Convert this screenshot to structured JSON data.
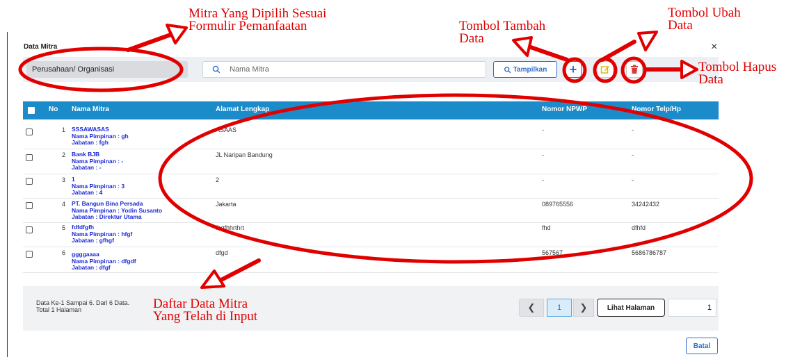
{
  "modal": {
    "title": "Data Mitra",
    "close": "×"
  },
  "filter": {
    "type_value": "Perusahaan/ Organisasi",
    "search_placeholder": "Nama Mitra",
    "search_value": "",
    "show_label": "Tampilkan"
  },
  "icons": {
    "search": "search-icon",
    "add": "plus-icon",
    "edit": "pencil-square-icon",
    "delete": "trash-icon",
    "close": "close-icon"
  },
  "colors": {
    "header_bg": "#1b8bc9",
    "accent": "#2f6ec7",
    "edit_icon": "#e0b400",
    "delete_icon": "#d83a3a",
    "name_text": "#1a28d6",
    "annotation": "#e10000"
  },
  "table": {
    "columns": [
      "No",
      "Nama Mitra",
      "Alamat Lengkap",
      "Nomor NPWP",
      "Nomor Telp/Hp"
    ],
    "rows": [
      {
        "no": "1",
        "name": "SSSAWASAS",
        "pimpinan": "Nama Pimpinan : gh",
        "jabatan": "Jabatan : fgh",
        "alamat": "ASAAS",
        "npwp": "-",
        "telp": "-"
      },
      {
        "no": "2",
        "name": "Bank BJB",
        "pimpinan": "Nama Pimpinan : -",
        "jabatan": "Jabatan : -",
        "alamat": "JL Naripan Bandung",
        "npwp": "-",
        "telp": "-"
      },
      {
        "no": "3",
        "name": "1",
        "pimpinan": "Nama Pimpinan : 3",
        "jabatan": "Jabatan : 4",
        "alamat": "2",
        "npwp": "-",
        "telp": "-"
      },
      {
        "no": "4",
        "name": "PT. Bangun Bina Persada",
        "pimpinan": "Nama Pimpinan : Yodin Susanto",
        "jabatan": "Jabatan : Direktur Utama",
        "alamat": "Jakarta",
        "npwp": "089765556",
        "telp": "34242432"
      },
      {
        "no": "5",
        "name": "fdfdfgfh",
        "pimpinan": "Nama Pimpinan : hfgf",
        "jabatan": "Jabatan : gfhgf",
        "alamat": "fhgfhhrthrt",
        "npwp": "fhd",
        "telp": "dfhfd"
      },
      {
        "no": "6",
        "name": "ggggaaaa",
        "pimpinan": "Nama Pimpinan : dfgdf",
        "jabatan": "Jabatan : dfgf",
        "alamat": "dfgd",
        "npwp": "567567",
        "telp": "5686786787"
      }
    ]
  },
  "footer": {
    "info_line1": "Data Ke-1 Sampai 6. Dari 6 Data.",
    "info_line2": "Total 1 Halaman",
    "prev": "❮",
    "current_page": "1",
    "next": "❯",
    "lihat_label": "Lihat Halaman",
    "page_input_value": "1",
    "batal_label": "Batal"
  },
  "annotations": {
    "mitra_line1": "Mitra Yang Dipilih Sesuai",
    "mitra_line2": "Formulir Pemanfaatan",
    "tambah_line1": "Tombol Tambah",
    "tambah_line2": "Data",
    "ubah_line1": "Tombol Ubah",
    "ubah_line2": "Data",
    "hapus_line1": "Tombol Hapus",
    "hapus_line2": "Data",
    "daftar_line1": "Daftar Data Mitra",
    "daftar_line2": "Yang Telah di Input"
  }
}
